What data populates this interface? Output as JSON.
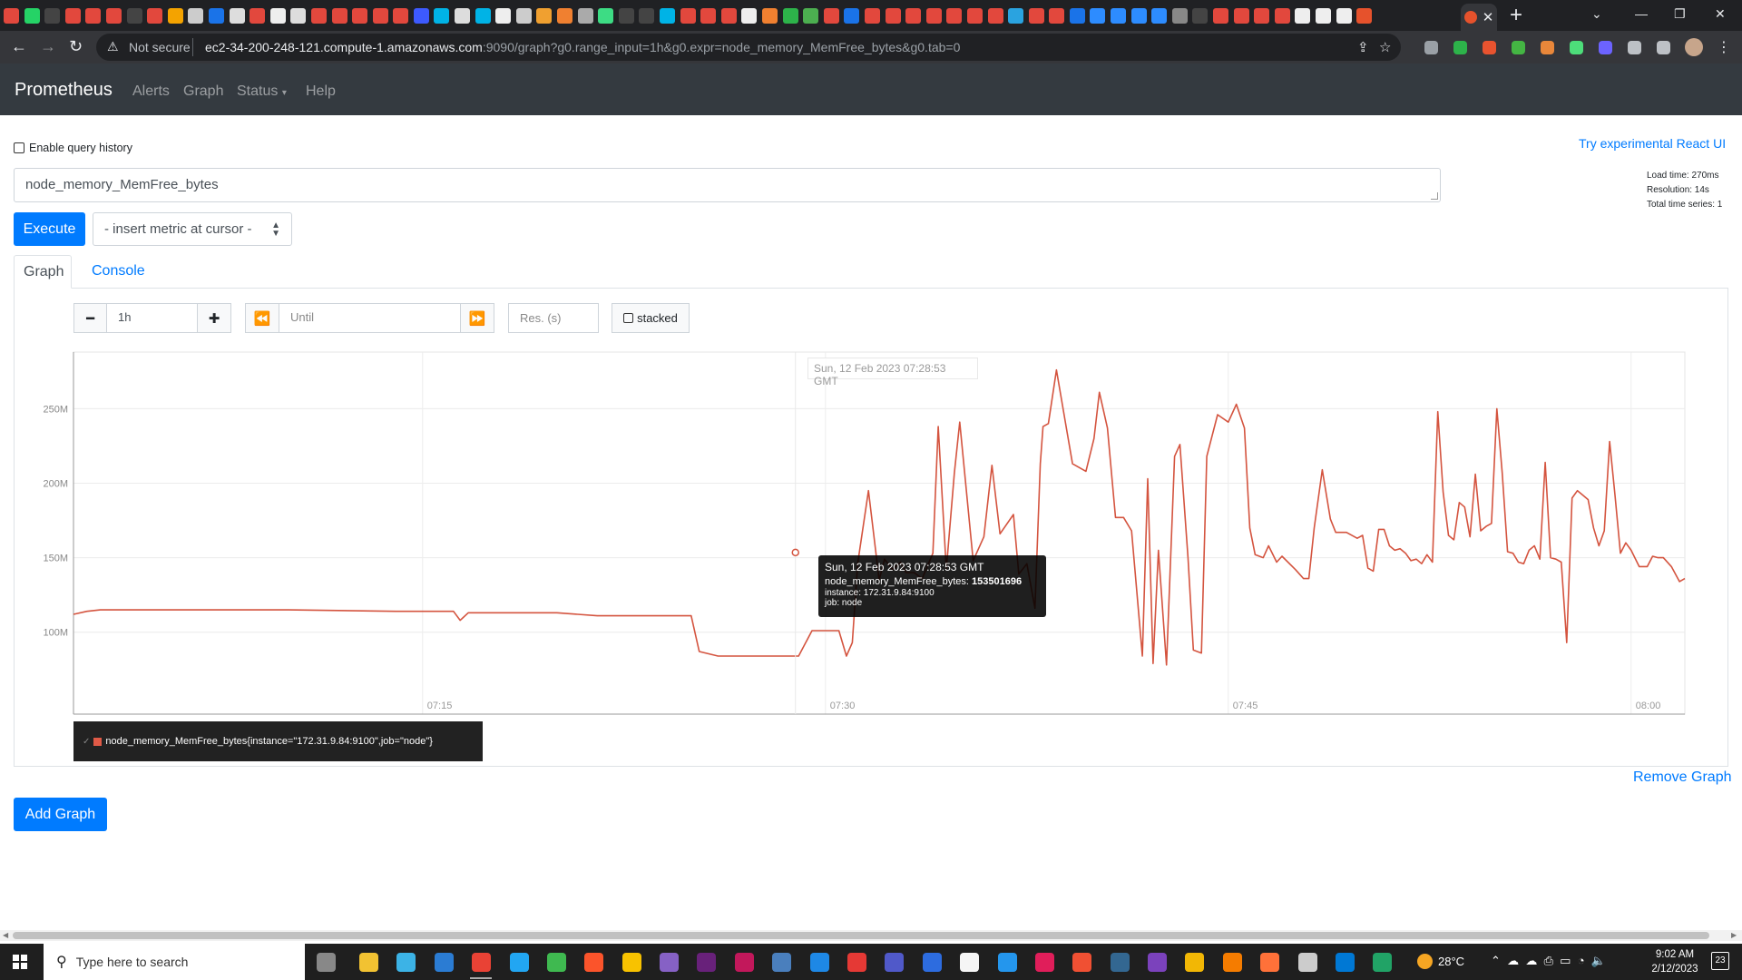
{
  "browser": {
    "url_warning": "Not secure",
    "url_host": "ec2-34-200-248-121.compute-1.amazonaws.com",
    "url_rest": ":9090/graph?g0.range_input=1h&g0.expr=node_memory_MemFree_bytes&g0.tab=0",
    "favicon_colors": [
      "#e2483d",
      "#25d366",
      "#444",
      "#e2483d",
      "#e2483d",
      "#e2483d",
      "#444",
      "#e2483d",
      "#f4a300",
      "#ccc",
      "#1a73e8",
      "#ddd",
      "#e2483d",
      "#eee",
      "#ddd",
      "#e2483d",
      "#e2483d",
      "#e2483d",
      "#e2483d",
      "#e2483d",
      "#3d5afe",
      "#00b3e6",
      "#ddd",
      "#00b3e6",
      "#eee",
      "#ccc",
      "#f0a030",
      "#f08030",
      "#aaa",
      "#3ddc84",
      "#444",
      "#444",
      "#00b3e6",
      "#e2483d",
      "#e2483d",
      "#e2483d",
      "#eee",
      "#f08030",
      "#2db34a",
      "#4caf50",
      "#e2483d",
      "#1a73e8",
      "#e2483d",
      "#e2483d",
      "#e2483d",
      "#e2483d",
      "#e2483d",
      "#e2483d",
      "#e2483d",
      "#2aa3e0",
      "#e2483d",
      "#e2483d",
      "#1a73e8",
      "#2d8cff",
      "#2d8cff",
      "#2d8cff",
      "#2d8cff",
      "#888",
      "#444",
      "#e2483d",
      "#e2483d",
      "#e2483d",
      "#e2483d",
      "#eee",
      "#eee",
      "#eee",
      "#e6522c"
    ]
  },
  "navbar": {
    "brand": "Prometheus",
    "links": [
      "Alerts",
      "Graph",
      "Status",
      "Help"
    ]
  },
  "page": {
    "query_history_label": "Enable query history",
    "react_link": "Try experimental React UI",
    "stats": {
      "load_time": "Load time: 270ms",
      "resolution": "Resolution: 14s",
      "total_series": "Total time series: 1"
    },
    "expression": "node_memory_MemFree_bytes",
    "execute_label": "Execute",
    "metric_select": "- insert metric at cursor -",
    "tabs": [
      "Graph",
      "Console"
    ],
    "controls": {
      "range_value": "1h",
      "until_placeholder": "Until",
      "res_placeholder": "Res. (s)",
      "stacked_label": "stacked"
    },
    "remove_graph": "Remove Graph",
    "add_graph": "Add Graph"
  },
  "tooltip": {
    "time": "Sun, 12 Feb 2023 07:28:53 GMT",
    "metric_label": "node_memory_MemFree_bytes:",
    "metric_value": "153501696",
    "instance": "instance: 172.31.9.84:9100",
    "job": "job: node"
  },
  "top_timestamp": "Sun, 12 Feb 2023 07:28:53 GMT",
  "legend_label": "node_memory_MemFree_bytes{instance=\"172.31.9.84:9100\",job=\"node\"}",
  "chart_data": {
    "type": "line",
    "title": "",
    "xlabel": "",
    "ylabel": "",
    "x_ticks": [
      "07:15",
      "07:30",
      "07:45",
      "08:00"
    ],
    "y_ticks": [
      "100M",
      "150M",
      "200M",
      "250M"
    ],
    "ylim": [
      45,
      288
    ],
    "xlim_minutes": [
      62,
      122
    ],
    "series": [
      {
        "name": "node_memory_MemFree_bytes{instance=\"172.31.9.84:9100\",job=\"node\"}",
        "color": "#d4543f",
        "x_minutes": [
          62.0,
          62.5,
          63.0,
          66.0,
          70.0,
          74.0,
          76.15,
          76.4,
          76.7,
          78.0,
          80.0,
          81.5,
          82.0,
          85.0,
          85.3,
          86.0,
          88.0,
          89.0,
          89.5,
          90.0,
          90.5,
          90.78,
          91.0,
          91.2,
          91.6,
          92.0,
          92.2,
          92.5,
          92.8,
          93.0,
          93.3,
          93.6,
          94.0,
          94.2,
          94.5,
          94.8,
          95.0,
          95.5,
          95.9,
          96.2,
          96.5,
          97.0,
          97.2,
          97.5,
          97.8,
          98.0,
          98.1,
          98.3,
          98.6,
          99.0,
          99.2,
          99.7,
          100.0,
          100.2,
          100.5,
          100.8,
          101.1,
          101.4,
          101.8,
          102.0,
          102.2,
          102.4,
          102.7,
          103.0,
          103.2,
          103.5,
          103.7,
          104.0,
          104.2,
          104.6,
          105.0,
          105.3,
          105.6,
          105.8,
          106.0,
          106.3,
          106.5,
          106.8,
          107.0,
          107.5,
          107.8,
          108.0,
          108.2,
          108.5,
          108.8,
          109.0,
          109.4,
          109.8,
          110.0,
          110.2,
          110.4,
          110.6,
          110.8,
          111.0,
          111.2,
          111.4,
          111.6,
          111.8,
          112.0,
          112.2,
          112.4,
          112.6,
          112.8,
          113.0,
          113.2,
          113.4,
          113.6,
          113.8,
          114.0,
          114.2,
          114.4,
          114.6,
          114.8,
          115.0,
          115.2,
          115.4,
          115.6,
          115.8,
          116.0,
          116.2,
          116.4,
          116.6,
          116.8,
          117.0,
          117.2,
          117.4,
          117.6,
          117.8,
          118.0,
          118.2,
          118.4,
          118.6,
          118.8,
          119.0,
          119.2,
          119.4,
          119.6,
          119.8,
          120.0,
          120.3,
          120.6,
          120.8,
          121.0,
          121.2,
          121.5,
          121.8,
          122.0
        ],
        "y_millions": [
          112,
          114,
          115,
          115,
          115,
          114,
          114,
          108,
          113,
          113,
          113,
          111,
          111,
          111,
          87,
          84,
          84,
          84,
          101,
          101,
          101,
          84,
          93,
          146,
          195,
          135,
          149,
          142,
          147,
          140,
          140,
          136,
          153,
          238,
          142,
          207,
          241,
          148,
          164,
          212,
          166,
          179,
          139,
          146,
          116,
          213,
          238,
          240,
          276,
          234,
          213,
          208,
          230,
          261,
          237,
          177,
          177,
          168,
          84,
          203,
          79,
          155,
          78,
          218,
          226,
          150,
          88,
          86,
          218,
          246,
          241,
          253,
          237,
          170,
          152,
          150,
          158,
          147,
          151,
          142,
          136,
          136,
          170,
          209,
          176,
          167,
          167,
          163,
          165,
          143,
          141,
          169,
          169,
          158,
          155,
          156,
          153,
          148,
          149,
          146,
          152,
          147,
          248,
          194,
          165,
          162,
          187,
          184,
          164,
          206,
          168,
          171,
          173,
          250,
          207,
          154,
          153,
          147,
          146,
          155,
          158,
          149,
          214,
          150,
          149,
          147,
          93,
          190,
          195,
          192,
          189,
          170,
          158,
          168,
          228,
          192,
          153,
          160,
          155,
          144,
          144,
          151,
          150,
          150,
          144,
          134,
          136,
          125,
          222,
          205,
          220,
          220,
          165,
          132,
          130,
          131,
          130,
          130,
          131,
          131,
          266,
          262,
          205,
          175,
          168
        ]
      }
    ]
  }
}
